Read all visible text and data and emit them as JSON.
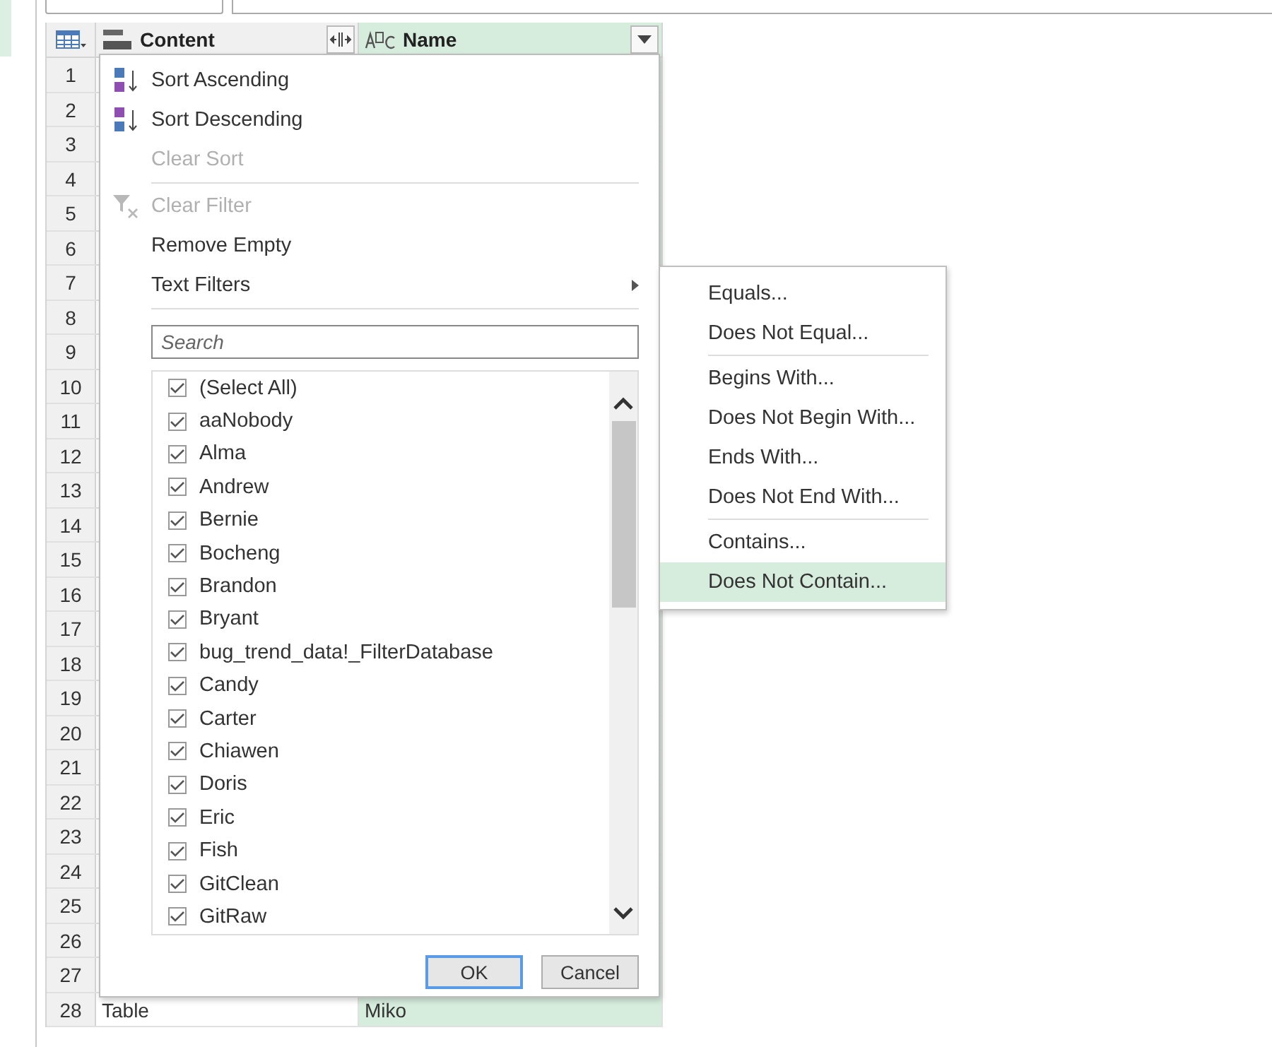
{
  "table": {
    "columns": [
      {
        "label": "Content",
        "kind": "any",
        "selected": false
      },
      {
        "label": "Name",
        "kind": "text",
        "selected": true
      }
    ],
    "rows": [
      {
        "number": "1"
      },
      {
        "number": "2"
      },
      {
        "number": "3"
      },
      {
        "number": "4"
      },
      {
        "number": "5"
      },
      {
        "number": "6"
      },
      {
        "number": "7"
      },
      {
        "number": "8"
      },
      {
        "number": "9"
      },
      {
        "number": "10"
      },
      {
        "number": "11"
      },
      {
        "number": "12"
      },
      {
        "number": "13"
      },
      {
        "number": "14"
      },
      {
        "number": "15"
      },
      {
        "number": "16"
      },
      {
        "number": "17"
      },
      {
        "number": "18"
      },
      {
        "number": "19"
      },
      {
        "number": "20"
      },
      {
        "number": "21"
      },
      {
        "number": "22"
      },
      {
        "number": "23"
      },
      {
        "number": "24"
      },
      {
        "number": "25"
      },
      {
        "number": "26"
      },
      {
        "number": "27"
      },
      {
        "number": "28",
        "cells": [
          "Table",
          "Miko"
        ]
      }
    ]
  },
  "filter_menu": {
    "sections": [
      [
        {
          "label": "Sort Ascending",
          "kind": "sort-ascending",
          "disabled": false
        },
        {
          "label": "Sort Descending",
          "kind": "sort-descending",
          "disabled": false
        },
        {
          "label": "Clear Sort",
          "kind": "plain",
          "disabled": true
        }
      ],
      [
        {
          "label": "Clear Filter",
          "kind": "clear-filter",
          "disabled": true
        },
        {
          "label": "Remove Empty",
          "kind": "plain",
          "disabled": false
        },
        {
          "label": "Text Filters",
          "kind": "submenu",
          "disabled": false
        }
      ]
    ],
    "search": {
      "placeholder": "Search"
    },
    "values": [
      {
        "label": "(Select All)",
        "checked": true
      },
      {
        "label": "aaNobody",
        "checked": true
      },
      {
        "label": "Alma",
        "checked": true
      },
      {
        "label": "Andrew",
        "checked": true
      },
      {
        "label": "Bernie",
        "checked": true
      },
      {
        "label": "Bocheng",
        "checked": true
      },
      {
        "label": "Brandon",
        "checked": true
      },
      {
        "label": "Bryant",
        "checked": true
      },
      {
        "label": "bug_trend_data!_FilterDatabase",
        "checked": true
      },
      {
        "label": "Candy",
        "checked": true
      },
      {
        "label": "Carter",
        "checked": true
      },
      {
        "label": "Chiawen",
        "checked": true
      },
      {
        "label": "Doris",
        "checked": true
      },
      {
        "label": "Eric",
        "checked": true
      },
      {
        "label": "Fish",
        "checked": true
      },
      {
        "label": "GitClean",
        "checked": true
      },
      {
        "label": "GitRaw",
        "checked": true
      }
    ],
    "buttons": [
      {
        "label": "OK",
        "default": true
      },
      {
        "label": "Cancel",
        "default": false
      }
    ]
  },
  "text_filters_menu": {
    "sections": [
      [
        {
          "label": "Equals...",
          "selected": false
        },
        {
          "label": "Does Not Equal...",
          "selected": false
        }
      ],
      [
        {
          "label": "Begins With...",
          "selected": false
        },
        {
          "label": "Does Not Begin With...",
          "selected": false
        },
        {
          "label": "Ends With...",
          "selected": false
        },
        {
          "label": "Does Not End With...",
          "selected": false
        }
      ],
      [
        {
          "label": "Contains...",
          "selected": false
        },
        {
          "label": "Does Not Contain...",
          "selected": true
        }
      ]
    ]
  }
}
